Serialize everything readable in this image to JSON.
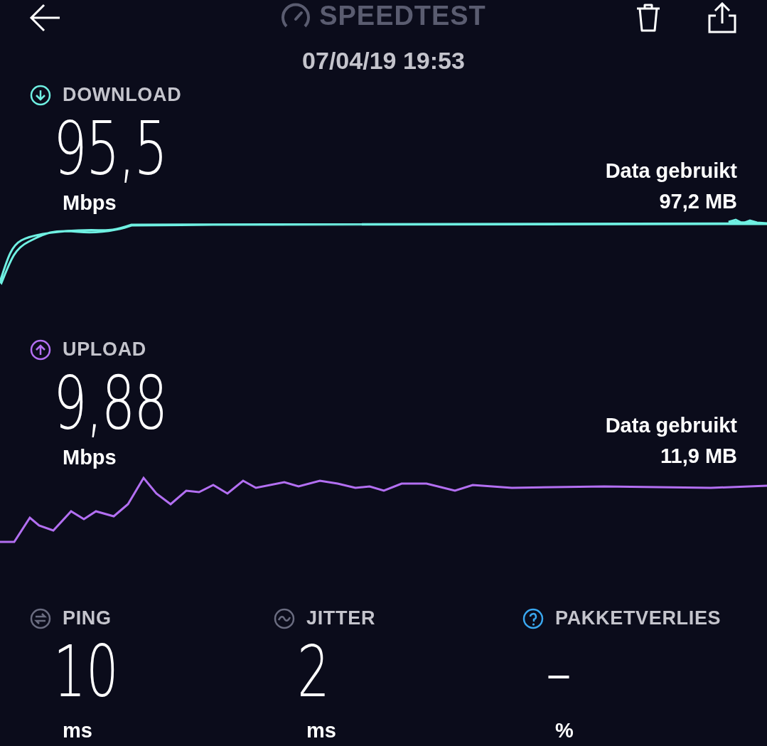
{
  "header": {
    "title": "SPEEDTEST",
    "date": "07/04/19 19:53"
  },
  "results": [
    {
      "kind": "download",
      "label": "DOWNLOAD",
      "value": "95,5",
      "unit": "Mbps",
      "data_label": "Data gebruikt",
      "data_value": "97,2 MB"
    },
    {
      "kind": "upload",
      "label": "UPLOAD",
      "value": "9,88",
      "unit": "Mbps",
      "data_label": "Data gebruikt",
      "data_value": "11,9 MB"
    }
  ],
  "stats": [
    {
      "kind": "ping",
      "label": "PING",
      "value": "10",
      "unit": "ms"
    },
    {
      "kind": "jitter",
      "label": "JITTER",
      "value": "2",
      "unit": "ms"
    },
    {
      "kind": "packet_loss",
      "label": "PAKKETVERLIES",
      "value": "–",
      "unit": "%"
    }
  ]
}
